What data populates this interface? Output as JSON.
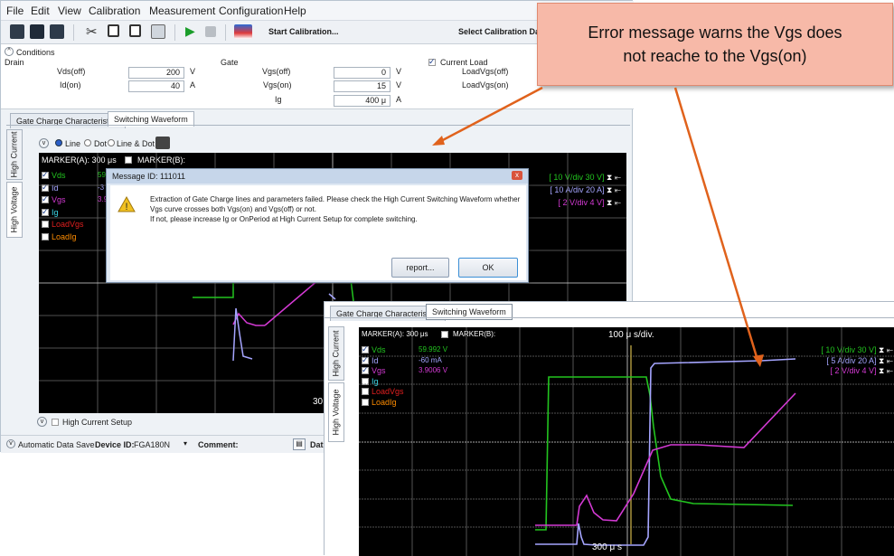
{
  "menu": [
    "File",
    "Edit",
    "View",
    "Calibration",
    "Measurement",
    "Configuration",
    "Help"
  ],
  "toolbar": {
    "start_calibration": "Start Calibration...",
    "select_calibration": "Select Calibration Data..."
  },
  "conditions": {
    "header": "Conditions",
    "drain": {
      "title": "Drain",
      "rows": [
        {
          "label": "Vds(off)",
          "value": "200",
          "unit": "V"
        },
        {
          "label": "Id(on)",
          "value": "40",
          "unit": "A"
        }
      ]
    },
    "gate": {
      "title": "Gate",
      "rows": [
        {
          "label": "Vgs(off)",
          "value": "0",
          "unit": "V"
        },
        {
          "label": "Vgs(on)",
          "value": "15",
          "unit": "V"
        },
        {
          "label": "Ig",
          "value": "400 μ",
          "unit": "A"
        }
      ]
    },
    "current_load": {
      "title": "Current Load",
      "rows": [
        {
          "label": "LoadVgs(off)"
        },
        {
          "label": "LoadVgs(on)"
        }
      ]
    }
  },
  "tabs": [
    "Gate Charge Characteristics",
    "Switching Waveform"
  ],
  "side_tabs": [
    "High Current",
    "High Voltage"
  ],
  "display_options": [
    "Line",
    "Dot",
    "Line & Dot"
  ],
  "markers": {
    "a": "MARKER(A): 300 μs",
    "b": "MARKER(B):"
  },
  "channels": [
    {
      "name": "Vds",
      "value": "59.",
      "color": "#22c41f",
      "checked": true
    },
    {
      "name": "Id",
      "value": "-3",
      "color": "#a5a5ff",
      "checked": true
    },
    {
      "name": "Vgs",
      "value": "3.9",
      "color": "#d43ad4",
      "checked": true
    },
    {
      "name": "Ig",
      "value": "",
      "color": "#3dd9ea",
      "checked": true
    },
    {
      "name": "LoadVgs",
      "value": "",
      "color": "#e01f1f",
      "checked": false
    },
    {
      "name": "LoadIg",
      "value": "",
      "color": "#ff8c00",
      "checked": false
    }
  ],
  "scales": [
    {
      "text": "[ 10  V/div 30  V]",
      "color": "#22c41f"
    },
    {
      "text": "[ 10  A/div 20  A]",
      "color": "#a5a5ff"
    },
    {
      "text": "[ 2  V/div 4  V]",
      "color": "#d43ad4"
    }
  ],
  "time_readout_main": "30",
  "high_current_setup": "High Current Setup",
  "status_bar": {
    "auto_save": "Automatic Data Save",
    "device_id_label": "Device ID:",
    "device_id_value": "FGA180N",
    "comment_label": "Comment:",
    "data_label": "Dat"
  },
  "dialog": {
    "title": "Message ID: 111011",
    "line1": "Extraction of Gate Charge lines and parameters failed. Please check the High Current Switching Waveform whether",
    "line2": "Vgs curve crosses both Vgs(on) and Vgs(off) or not.",
    "line3": "If not, please increase Ig or OnPeriod at High Current Setup for complete switching.",
    "report_button": "report...",
    "ok_button": "OK"
  },
  "callout": {
    "line1": "Error message warns the Vgs does",
    "line2": "not reache to the Vgs(on)"
  },
  "zoom": {
    "tabs": [
      "Gate Charge Characteristics",
      "Switching Waveform"
    ],
    "marker_a": "MARKER(A): 300 μs",
    "marker_b": "MARKER(B):",
    "time_div": "100 μ s/div.",
    "time_readout": "300 μ s",
    "channels": [
      {
        "name": "Vds",
        "value": "59.992 V",
        "color": "#22c41f",
        "checked": true
      },
      {
        "name": "Id",
        "value": "-60 mA",
        "color": "#a5a5ff",
        "checked": true
      },
      {
        "name": "Vgs",
        "value": "3.9006 V",
        "color": "#d43ad4",
        "checked": true
      },
      {
        "name": "Ig",
        "value": "",
        "color": "#3dd9ea",
        "checked": false
      },
      {
        "name": "LoadVgs",
        "value": "",
        "color": "#e01f1f",
        "checked": false
      },
      {
        "name": "LoadIg",
        "value": "",
        "color": "#ff8c00",
        "checked": false
      }
    ],
    "scales": [
      {
        "text": "[ 10  V/div 30  V]",
        "color": "#22c41f"
      },
      {
        "text": "[ 5  A/div 20  A]",
        "color": "#a5a5ff"
      },
      {
        "text": "[ 2  V/div 4  V]",
        "color": "#d43ad4"
      }
    ]
  },
  "colors": {
    "callout_fill": "#f7b9a8",
    "arrow": "#e0621c",
    "scope_bg": "#000000"
  }
}
